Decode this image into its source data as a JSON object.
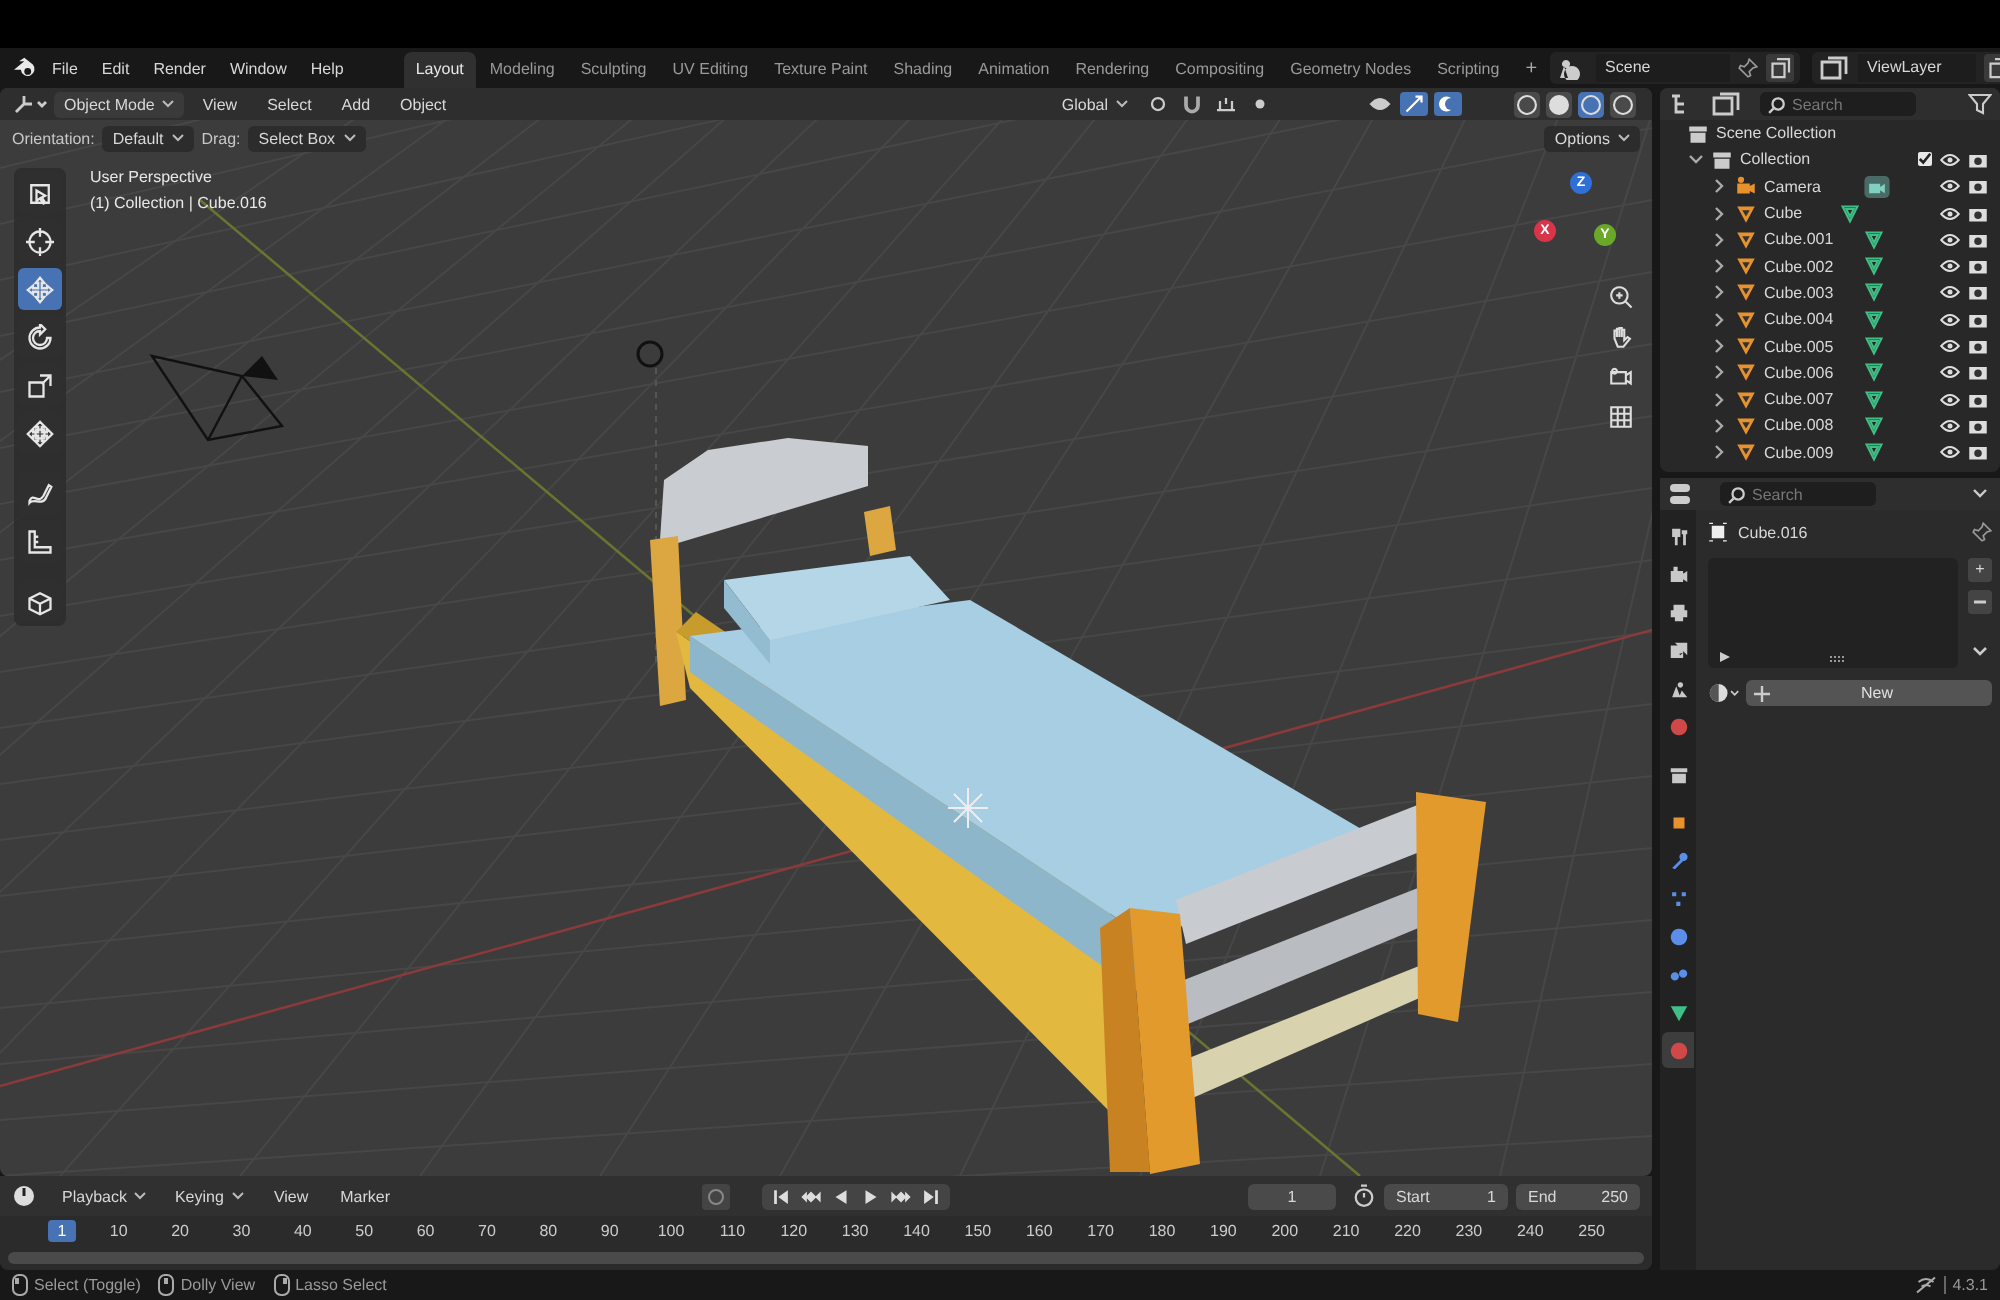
{
  "menu_bar": {
    "menus": [
      "File",
      "Edit",
      "Render",
      "Window",
      "Help"
    ]
  },
  "workspaces": [
    {
      "label": "Layout",
      "selected": true
    },
    {
      "label": "Modeling",
      "selected": false
    },
    {
      "label": "Sculpting",
      "selected": false
    },
    {
      "label": "UV Editing",
      "selected": false
    },
    {
      "label": "Texture Paint",
      "selected": false
    },
    {
      "label": "Shading",
      "selected": false
    },
    {
      "label": "Animation",
      "selected": false
    },
    {
      "label": "Rendering",
      "selected": false
    },
    {
      "label": "Compositing",
      "selected": false
    },
    {
      "label": "Geometry Nodes",
      "selected": false
    },
    {
      "label": "Scripting",
      "selected": false
    }
  ],
  "add_workspace": "+",
  "scene": {
    "value": "Scene"
  },
  "view_layer": {
    "value": "ViewLayer"
  },
  "viewport_header": {
    "mode": "Object Mode",
    "menus": [
      "View",
      "Select",
      "Add",
      "Object"
    ],
    "orientation": "Global",
    "shading_modes": [
      {
        "selected": false
      },
      {
        "selected": false
      },
      {
        "selected": true
      },
      {
        "selected": false
      }
    ]
  },
  "tool_settings": {
    "orientation_label": "Orientation:",
    "orientation": "Default",
    "drag_label": "Drag:",
    "drag": "Select Box",
    "options": "Options"
  },
  "viewport": {
    "perspective": "User Perspective",
    "context": "(1) Collection | Cube.016",
    "tools": [
      {
        "selected": false
      },
      {
        "selected": false
      },
      {
        "selected": true
      },
      {
        "selected": false
      },
      {
        "selected": false
      },
      {
        "selected": false
      },
      {
        "selected": false
      },
      {
        "selected": false
      },
      {
        "selected": false
      }
    ],
    "axes": [
      {
        "label": "Z",
        "color": "#2f6fd8"
      },
      {
        "label": "Y",
        "color": "#6aa82a"
      },
      {
        "label": "X",
        "color": "#d8354a"
      }
    ]
  },
  "outliner": {
    "search_placeholder": "Search",
    "root": "Scene Collection",
    "collection": {
      "name": "Collection",
      "expanded": true,
      "checked": true,
      "children": [
        {
          "name": "Camera",
          "kind": "camera",
          "expanded": false
        },
        {
          "name": "Cube",
          "kind": "mesh",
          "expanded": false
        },
        {
          "name": "Cube.001",
          "kind": "mesh",
          "expanded": false
        },
        {
          "name": "Cube.002",
          "kind": "mesh",
          "expanded": false
        },
        {
          "name": "Cube.003",
          "kind": "mesh",
          "expanded": false
        },
        {
          "name": "Cube.004",
          "kind": "mesh",
          "expanded": false
        },
        {
          "name": "Cube.005",
          "kind": "mesh",
          "expanded": false
        },
        {
          "name": "Cube.006",
          "kind": "mesh",
          "expanded": false
        },
        {
          "name": "Cube.007",
          "kind": "mesh",
          "expanded": false
        },
        {
          "name": "Cube.008",
          "kind": "mesh",
          "expanded": false
        },
        {
          "name": "Cube.009",
          "kind": "mesh",
          "expanded": false
        }
      ]
    }
  },
  "properties": {
    "search_placeholder": "Search",
    "object": "Cube.016",
    "new_button": "New",
    "slot_plus": "+",
    "tabs": [
      {
        "selected": false
      },
      {
        "selected": false
      },
      {
        "selected": false
      },
      {
        "selected": false
      },
      {
        "selected": false
      },
      {
        "selected": false
      },
      {
        "selected": false
      },
      {
        "selected": false
      },
      {
        "selected": false
      },
      {
        "selected": false
      },
      {
        "selected": false
      },
      {
        "selected": false
      },
      {
        "selected": false
      },
      {
        "selected": true
      }
    ]
  },
  "timeline": {
    "menus": [
      "Playback",
      "Keying",
      "View",
      "Marker"
    ],
    "current_frame": "1",
    "start_label": "Start",
    "start": "1",
    "end_label": "End",
    "end": "250",
    "playhead": "1",
    "ticks": [
      "10",
      "20",
      "30",
      "40",
      "50",
      "60",
      "70",
      "80",
      "90",
      "100",
      "110",
      "120",
      "130",
      "140",
      "150",
      "160",
      "170",
      "180",
      "190",
      "200",
      "210",
      "220",
      "230",
      "240",
      "250"
    ]
  },
  "status_bar": {
    "hints": [
      "Select (Toggle)",
      "Dolly View",
      "Lasso Select"
    ],
    "version": "4.3.1"
  }
}
